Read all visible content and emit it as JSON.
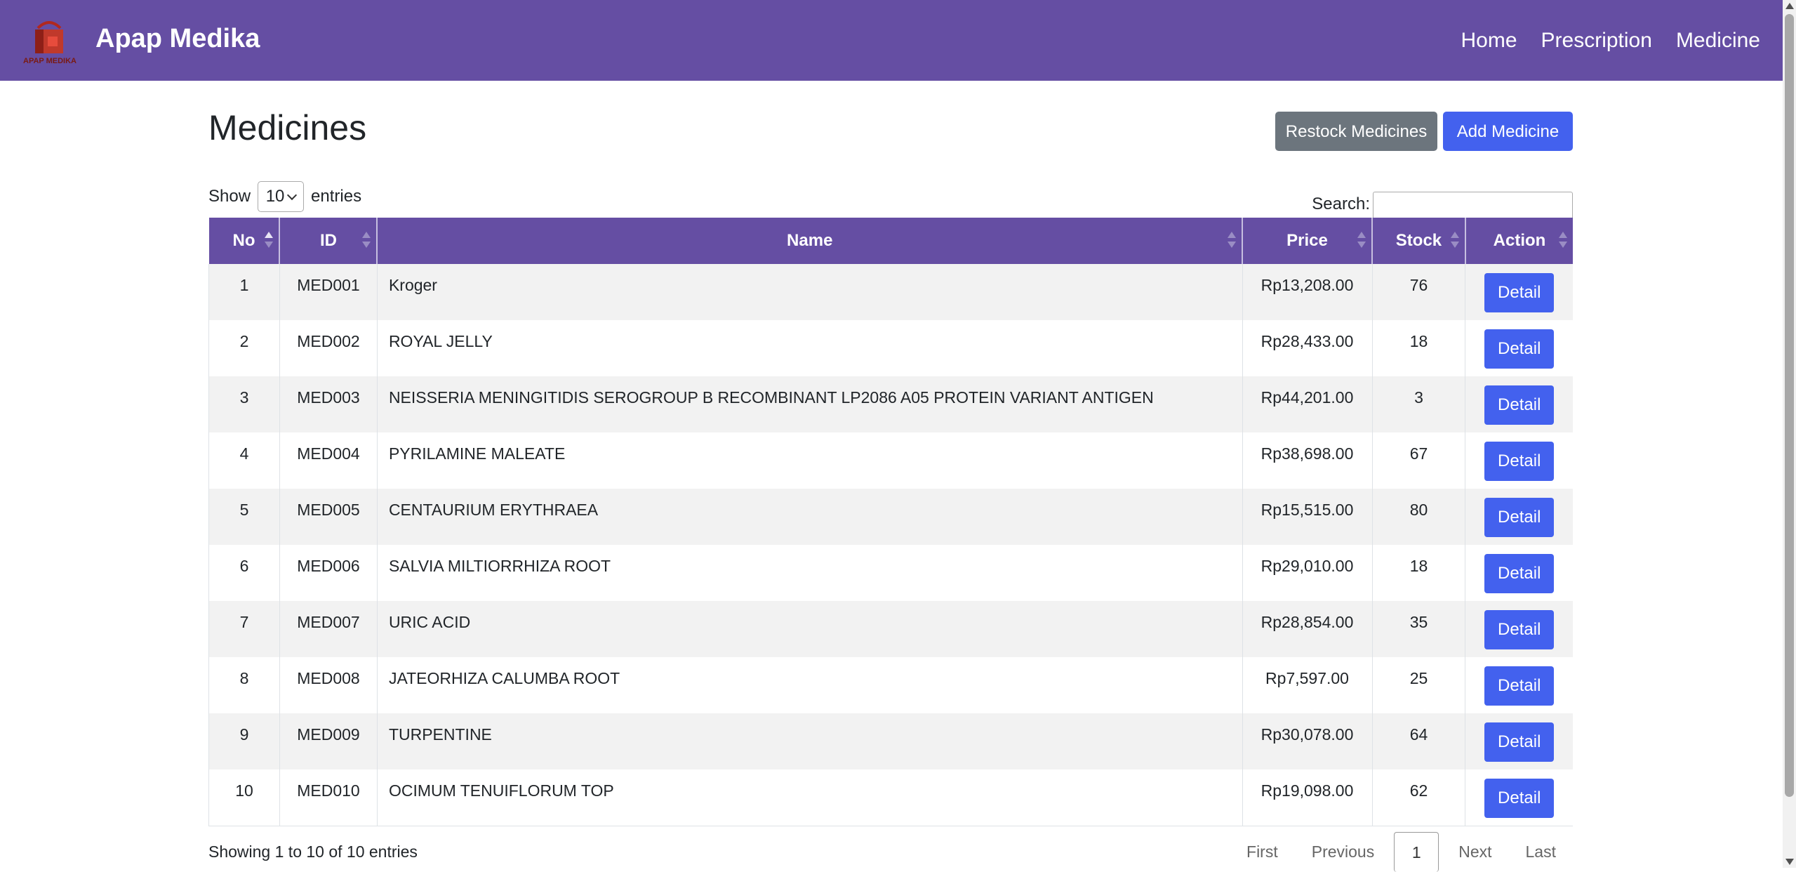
{
  "navbar": {
    "brand": "Apap Medika",
    "logo_text": "APAP MEDIKA",
    "links": [
      "Home",
      "Prescription",
      "Medicine"
    ]
  },
  "page": {
    "title": "Medicines",
    "restock_label": "Restock Medicines",
    "add_label": "Add Medicine",
    "show_label": "Show",
    "entries_value": "10",
    "entries_label": "entries",
    "search_label": "Search:"
  },
  "table": {
    "columns": [
      "No",
      "ID",
      "Name",
      "Price",
      "Stock",
      "Action"
    ],
    "detail_label": "Detail",
    "rows": [
      {
        "no": "1",
        "id": "MED001",
        "name": "Kroger",
        "price": "Rp13,208.00",
        "stock": "76"
      },
      {
        "no": "2",
        "id": "MED002",
        "name": "ROYAL JELLY",
        "price": "Rp28,433.00",
        "stock": "18"
      },
      {
        "no": "3",
        "id": "MED003",
        "name": "NEISSERIA MENINGITIDIS SEROGROUP B RECOMBINANT LP2086 A05 PROTEIN VARIANT ANTIGEN",
        "price": "Rp44,201.00",
        "stock": "3"
      },
      {
        "no": "4",
        "id": "MED004",
        "name": "PYRILAMINE MALEATE",
        "price": "Rp38,698.00",
        "stock": "67"
      },
      {
        "no": "5",
        "id": "MED005",
        "name": "CENTAURIUM ERYTHRAEA",
        "price": "Rp15,515.00",
        "stock": "80"
      },
      {
        "no": "6",
        "id": "MED006",
        "name": "SALVIA MILTIORRHIZA ROOT",
        "price": "Rp29,010.00",
        "stock": "18"
      },
      {
        "no": "7",
        "id": "MED007",
        "name": "URIC ACID",
        "price": "Rp28,854.00",
        "stock": "35"
      },
      {
        "no": "8",
        "id": "MED008",
        "name": "JATEORHIZA CALUMBA ROOT",
        "price": "Rp7,597.00",
        "stock": "25"
      },
      {
        "no": "9",
        "id": "MED009",
        "name": "TURPENTINE",
        "price": "Rp30,078.00",
        "stock": "64"
      },
      {
        "no": "10",
        "id": "MED010",
        "name": "OCIMUM TENUIFLORUM TOP",
        "price": "Rp19,098.00",
        "stock": "62"
      }
    ]
  },
  "footer": {
    "info": "Showing 1 to 10 of 10 entries",
    "first": "First",
    "previous": "Previous",
    "current": "1",
    "next": "Next",
    "last": "Last"
  },
  "colors": {
    "primary": "#654ea3",
    "button_blue": "#4361ee",
    "button_gray": "#6c757d"
  }
}
